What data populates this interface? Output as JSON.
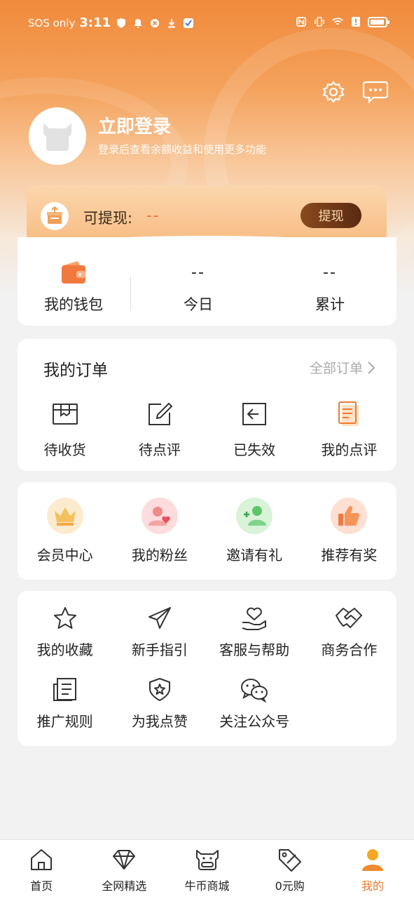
{
  "status_bar": {
    "carrier": "SOS only",
    "time": "3:11"
  },
  "profile": {
    "login_title": "立即登录",
    "login_subtitle": "登录后查看余额收益和使用更多功能"
  },
  "withdraw": {
    "label": "可提现:",
    "value": "--",
    "button": "提现"
  },
  "wallet": {
    "items": [
      {
        "label": "我的钱包",
        "icon": "wallet-icon"
      },
      {
        "value": "--",
        "label": "今日"
      },
      {
        "value": "--",
        "label": "累计"
      }
    ]
  },
  "orders": {
    "title": "我的订单",
    "all_link": "全部订单",
    "items": [
      {
        "label": "待收货",
        "icon": "package-icon"
      },
      {
        "label": "待点评",
        "icon": "edit-icon"
      },
      {
        "label": "已失效",
        "icon": "expired-icon"
      },
      {
        "label": "我的点评",
        "icon": "review-icon"
      }
    ]
  },
  "benefits": {
    "items": [
      {
        "label": "会员中心",
        "icon": "crown-icon"
      },
      {
        "label": "我的粉丝",
        "icon": "fans-icon"
      },
      {
        "label": "邀请有礼",
        "icon": "invite-icon"
      },
      {
        "label": "推荐有奖",
        "icon": "thumbs-up-icon"
      }
    ]
  },
  "tools": {
    "items": [
      {
        "label": "我的收藏",
        "icon": "star-icon"
      },
      {
        "label": "新手指引",
        "icon": "paper-plane-icon"
      },
      {
        "label": "客服与帮助",
        "icon": "heart-hand-icon"
      },
      {
        "label": "商务合作",
        "icon": "handshake-icon"
      },
      {
        "label": "推广规则",
        "icon": "rules-icon"
      },
      {
        "label": "为我点赞",
        "icon": "shield-star-icon"
      },
      {
        "label": "关注公众号",
        "icon": "wechat-icon"
      }
    ]
  },
  "tabbar": {
    "items": [
      {
        "label": "首页",
        "icon": "home-icon"
      },
      {
        "label": "全网精选",
        "icon": "diamond-icon"
      },
      {
        "label": "牛币商城",
        "icon": "cow-icon"
      },
      {
        "label": "0元购",
        "icon": "tag-icon"
      },
      {
        "label": "我的",
        "icon": "user-icon",
        "active": true
      }
    ]
  },
  "colors": {
    "accent": "#f07a30",
    "header": "#f08a3b"
  }
}
